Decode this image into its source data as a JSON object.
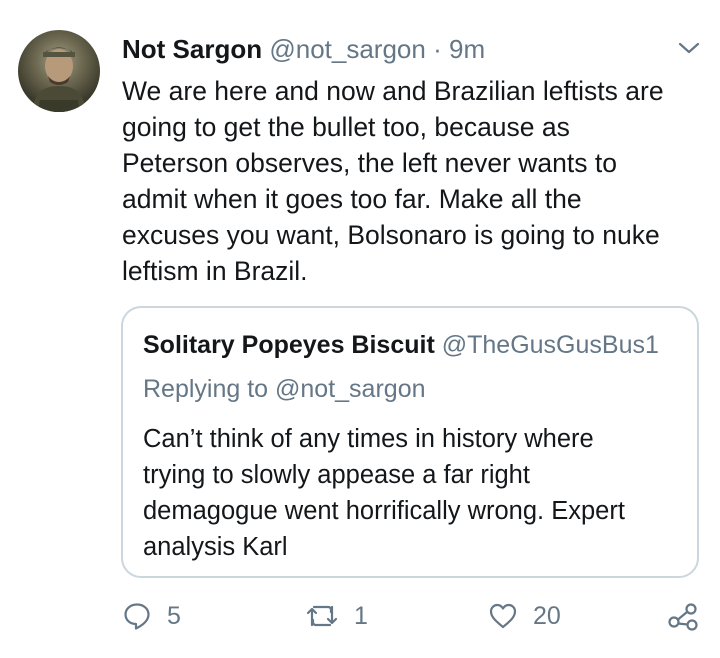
{
  "tweet": {
    "author_name": "Not Sargon",
    "author_handle": "@not_sargon",
    "separator": "·",
    "time": "9m",
    "text": "We are here and now and Brazilian leftists are\ngoing to get the bullet too, because as\nPeterson observes, the left never wants to\nadmit when it goes too far. Make all the\nexcuses you want, Bolsonaro is going to nuke\nleftism in Brazil."
  },
  "quote": {
    "author_name": "Solitary Popeyes Biscuit",
    "author_handle": "@TheGusGusBus1",
    "replying_to": "Replying to @not_sargon",
    "text": "Can’t think of any times in history where\ntrying to slowly appease a far right\ndemagogue went horrifically wrong. Expert\nanalysis Karl"
  },
  "actions": {
    "reply_count": "5",
    "retweet_count": "1",
    "like_count": "20"
  },
  "icons": {
    "reply": "reply-icon",
    "retweet": "retweet-icon",
    "like": "heart-icon",
    "share": "share-icon",
    "menu": "chevron-down-icon"
  },
  "colors": {
    "text": "#14171a",
    "secondary": "#657786",
    "border": "#ccd6dd"
  }
}
